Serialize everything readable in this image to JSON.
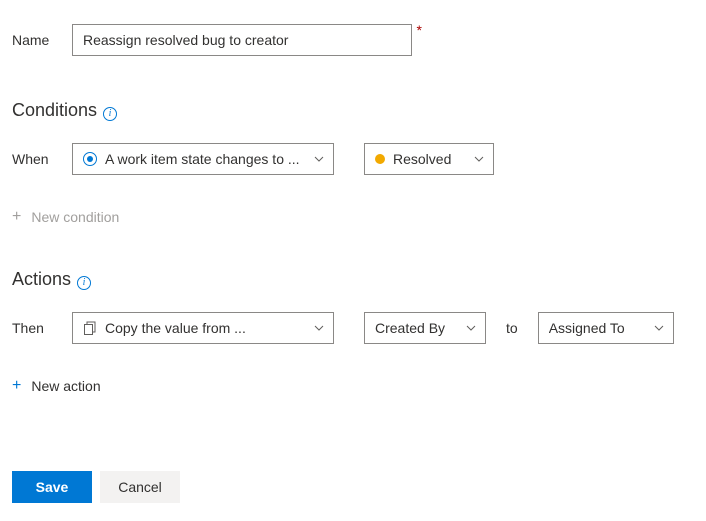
{
  "name": {
    "label": "Name",
    "value": "Reassign resolved bug to creator"
  },
  "conditions": {
    "title": "Conditions",
    "when_label": "When",
    "trigger": "A work item state changes to ...",
    "state": {
      "label": "Resolved",
      "color": "#f2a900"
    },
    "add_label": "New condition"
  },
  "actions": {
    "title": "Actions",
    "then_label": "Then",
    "action": "Copy the value from ...",
    "source_field": "Created By",
    "to_label": "to",
    "target_field": "Assigned To",
    "add_label": "New action"
  },
  "buttons": {
    "save": "Save",
    "cancel": "Cancel"
  }
}
